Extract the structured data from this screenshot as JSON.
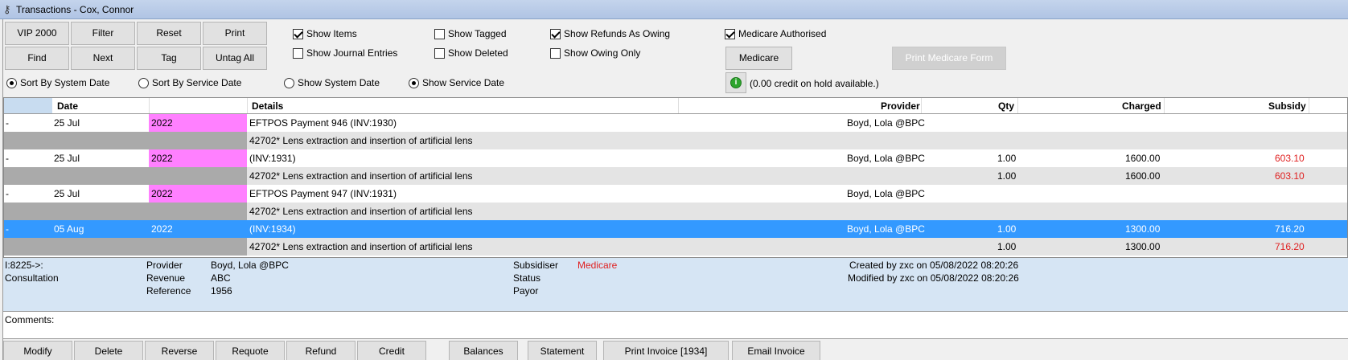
{
  "window": {
    "title": "Transactions - Cox, Connor",
    "icon": "key-icon"
  },
  "toolbar": {
    "row1": [
      "VIP 2000",
      "Filter",
      "Reset",
      "Print"
    ],
    "row2": [
      "Find",
      "Next",
      "Tag",
      "Untag All"
    ]
  },
  "checkboxes": {
    "show_items": {
      "label": "Show Items",
      "checked": true
    },
    "show_journal": {
      "label": "Show Journal Entries",
      "checked": false
    },
    "show_tagged": {
      "label": "Show Tagged",
      "checked": false
    },
    "show_deleted": {
      "label": "Show Deleted",
      "checked": false
    },
    "show_refunds": {
      "label": "Show Refunds As Owing",
      "checked": true
    },
    "show_owing": {
      "label": "Show Owing Only",
      "checked": false
    },
    "medicare_auth": {
      "label": "Medicare Authorised",
      "checked": true
    }
  },
  "radios": {
    "sort_system": {
      "label": "Sort By System Date",
      "checked": true
    },
    "sort_service": {
      "label": "Sort By Service Date",
      "checked": false
    },
    "show_system": {
      "label": "Show System Date",
      "checked": false
    },
    "show_service": {
      "label": "Show Service Date",
      "checked": true
    }
  },
  "medicare_button": "Medicare",
  "print_medicare_button": "Print Medicare Form",
  "credit_info": "(0.00 credit on hold available.)",
  "grid": {
    "headers": {
      "date": "Date",
      "details": "Details",
      "provider": "Provider",
      "qty": "Qty",
      "charged": "Charged",
      "subsidy": "Subsidy"
    },
    "rows": [
      {
        "dash": "-",
        "date": "25 Jul",
        "year": "2022",
        "details": "EFTPOS Payment  946  (INV:1930)",
        "provider": "Boyd, Lola @BPC",
        "qty": "",
        "charged": "",
        "subsidy": ""
      },
      {
        "sub": "42702* Lens extraction and insertion of artificial lens",
        "qty": "",
        "charged": "",
        "subsidy": ""
      },
      {
        "dash": "-",
        "date": "25 Jul",
        "year": "2022",
        "details": " (INV:1931)",
        "provider": "Boyd, Lola @BPC",
        "qty": "1.00",
        "charged": "1600.00",
        "subsidy": "603.10"
      },
      {
        "sub": "42702* Lens extraction and insertion of artificial lens",
        "qty": "1.00",
        "charged": "1600.00",
        "subsidy": "603.10"
      },
      {
        "dash": "-",
        "date": "25 Jul",
        "year": "2022",
        "details": "EFTPOS Payment  947  (INV:1931)",
        "provider": "Boyd, Lola @BPC",
        "qty": "",
        "charged": "",
        "subsidy": ""
      },
      {
        "sub": "42702* Lens extraction and insertion of artificial lens",
        "qty": "",
        "charged": "",
        "subsidy": ""
      },
      {
        "dash": "-",
        "date": "05 Aug",
        "year": "2022",
        "details": " (INV:1934)",
        "provider": "Boyd, Lola @BPC",
        "qty": "1.00",
        "charged": "1300.00",
        "subsidy": "716.20"
      },
      {
        "sub": "42702* Lens extraction and insertion of artificial lens",
        "qty": "1.00",
        "charged": "1300.00",
        "subsidy": "716.20"
      }
    ]
  },
  "detail": {
    "id": "I:8225->:",
    "type": "Consultation",
    "provider_label": "Provider",
    "provider": "Boyd, Lola @BPC",
    "revenue_label": "Revenue",
    "revenue": "ABC",
    "reference_label": "Reference",
    "reference": "1956",
    "subsidiser_label": "Subsidiser",
    "subsidiser": "Medicare",
    "status_label": "Status",
    "payor_label": "Payor",
    "created": "Created by zxc on 05/08/2022 08:20:26",
    "modified": "Modified by zxc on 05/08/2022 08:20:26"
  },
  "comments_label": "Comments:",
  "bottom_buttons": [
    "Modify",
    "Delete",
    "Reverse",
    "Requote",
    "Refund",
    "Credit",
    "Balances",
    "Statement",
    "Print Invoice [1934]",
    "Email Invoice"
  ],
  "colors": {
    "selected": "#3399ff",
    "year_highlight": "#ff80ff",
    "subsidy_red": "#e02020"
  }
}
